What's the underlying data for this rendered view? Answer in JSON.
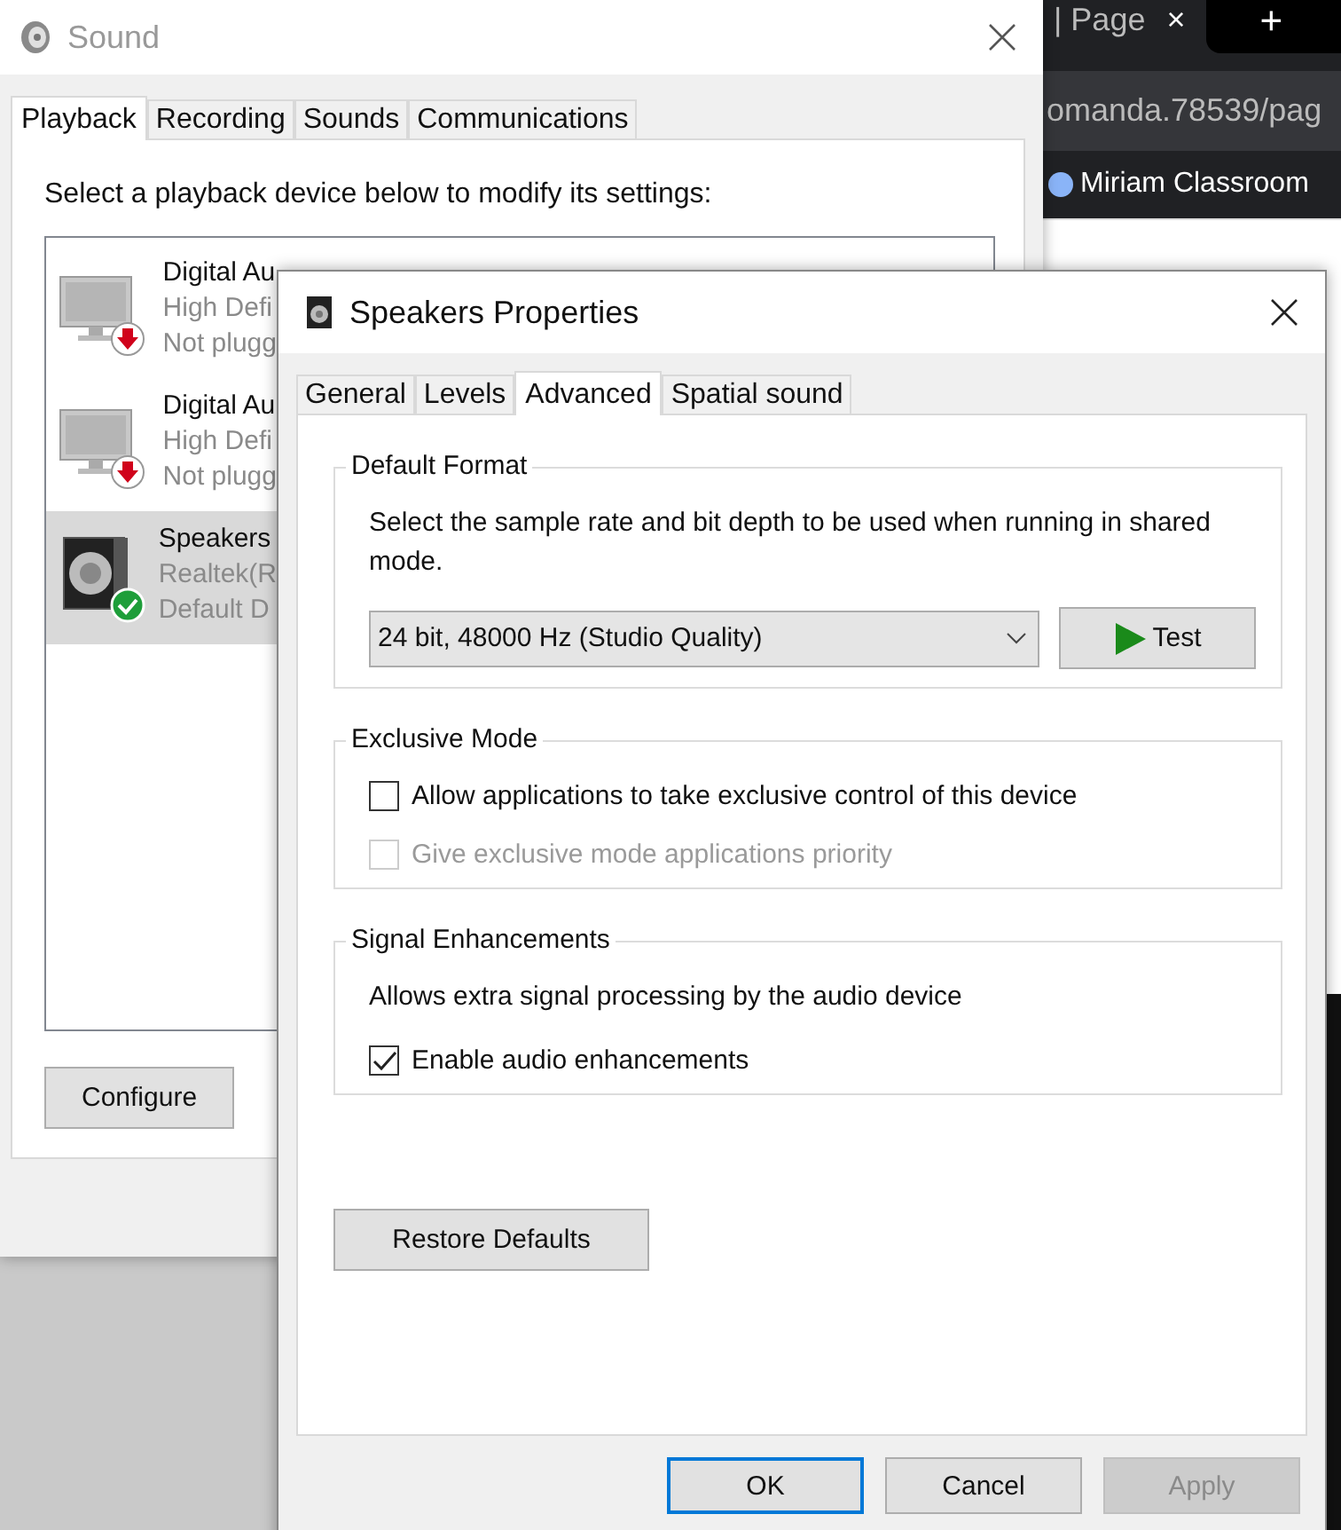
{
  "background_browser": {
    "tab_title": "| Page",
    "tab_close": "×",
    "new_tab": "+",
    "address": "omanda.78539/pag",
    "bookmark": "Miriam Classroom"
  },
  "sound_window": {
    "title": "Sound",
    "tabs": [
      {
        "label": "Playback",
        "selected": true
      },
      {
        "label": "Recording",
        "selected": false
      },
      {
        "label": "Sounds",
        "selected": false
      },
      {
        "label": "Communications",
        "selected": false
      }
    ],
    "instruction": "Select a playback device below to modify its settings:",
    "devices": [
      {
        "kind": "monitor",
        "name": "Digital Au",
        "description": "High Defi",
        "status": "Not plugg",
        "unplugged": true,
        "default_device": false,
        "selected": false
      },
      {
        "kind": "monitor",
        "name": "Digital Au",
        "description": "High Defi",
        "status": "Not plugg",
        "unplugged": true,
        "default_device": false,
        "selected": false
      },
      {
        "kind": "speaker",
        "name": "Speakers",
        "description": "Realtek(R",
        "status": "Default D",
        "unplugged": false,
        "default_device": true,
        "selected": true
      }
    ],
    "buttons": [
      "Configure"
    ]
  },
  "properties_window": {
    "title": "Speakers Properties",
    "tabs": [
      {
        "label": "General",
        "selected": false
      },
      {
        "label": "Levels",
        "selected": false
      },
      {
        "label": "Advanced",
        "selected": true
      },
      {
        "label": "Spatial sound",
        "selected": false
      }
    ],
    "sections": [
      {
        "title": "Default Format",
        "items": [
          {
            "kind": "text",
            "text": "Select the sample rate and bit depth to be used when running in shared mode."
          },
          {
            "kind": "format",
            "value": "24 bit, 48000 Hz (Studio Quality)",
            "button": "Test"
          }
        ]
      },
      {
        "title": "Exclusive Mode",
        "items": [
          {
            "kind": "checkbox",
            "label": "Allow applications to take exclusive control of this device",
            "checked": false,
            "disabled": false
          },
          {
            "kind": "checkbox",
            "label": "Give exclusive mode applications priority",
            "checked": false,
            "disabled": true
          }
        ]
      },
      {
        "title": "Signal Enhancements",
        "items": [
          {
            "kind": "text",
            "text": "Allows extra signal processing by the audio device"
          },
          {
            "kind": "checkbox",
            "label": "Enable audio enhancements",
            "checked": true,
            "disabled": false
          }
        ]
      }
    ],
    "restore_button": "Restore Defaults",
    "buttons": [
      {
        "label": "OK",
        "default": true,
        "disabled": false
      },
      {
        "label": "Cancel",
        "default": false,
        "disabled": false
      },
      {
        "label": "Apply",
        "default": false,
        "disabled": true
      }
    ]
  }
}
